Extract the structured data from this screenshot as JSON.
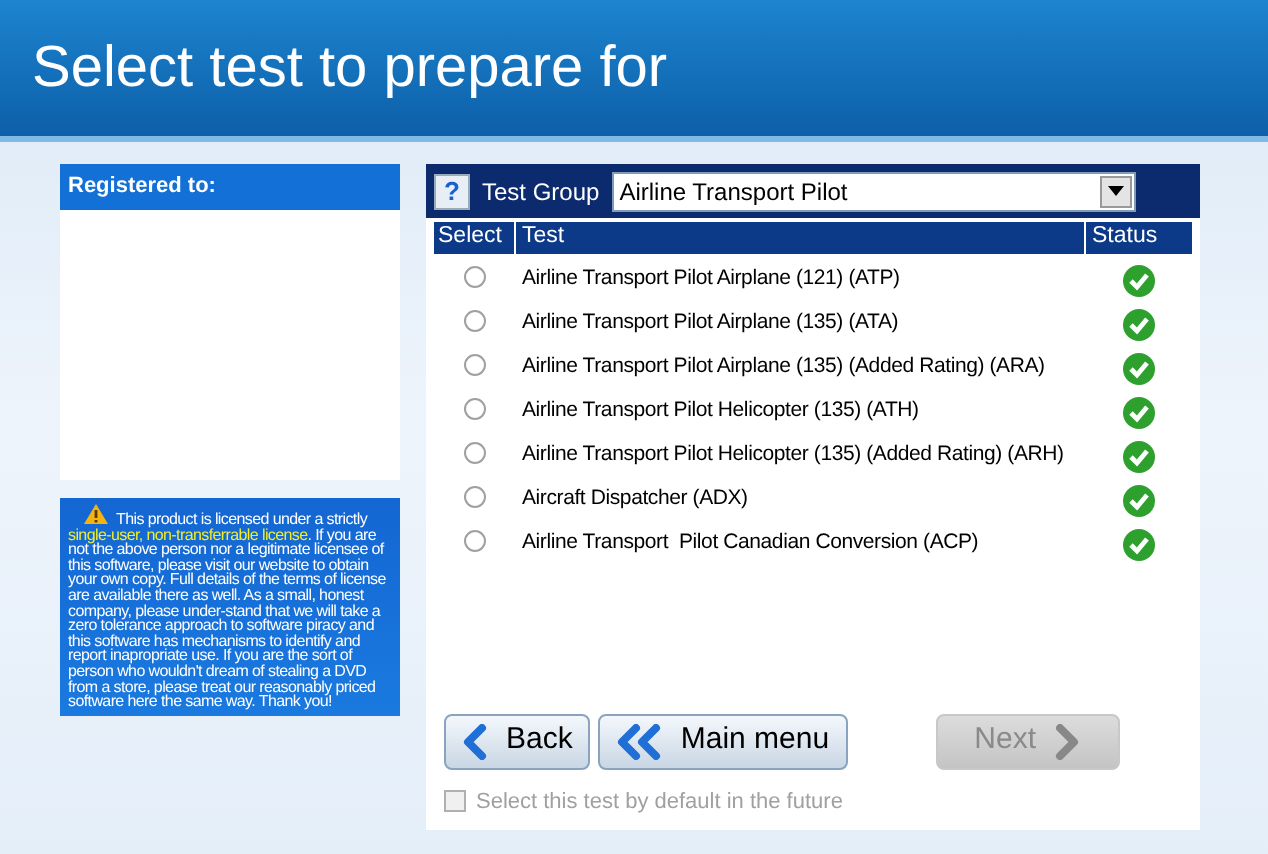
{
  "header": {
    "title": "Select test to prepare for"
  },
  "registration": {
    "heading": "Registered to:"
  },
  "license": {
    "text_before": "This product is licensed under a strictly ",
    "highlight": "single-user, non-transferrable license",
    "text_after": ".  If you are not the above person nor a legitimate licensee of this software, please visit our website to obtain your own copy.  Full details of the terms of license are available there as well. As a small, honest company, please under-stand that we will take a zero tolerance approach to software piracy and this software has mechanisms to identify and report inapropriate use.  If you are the sort of person who wouldn't dream of stealing a DVD from a store, please treat our reasonably priced software here the same way.  Thank you!"
  },
  "toolbar": {
    "help": "?",
    "label": "Test Group",
    "value": "Airline Transport Pilot"
  },
  "table": {
    "columns": [
      "Select",
      "Test",
      "Status"
    ],
    "rows": [
      {
        "test": "Airline Transport Pilot Airplane (121) (ATP)",
        "selected": false,
        "passed": true
      },
      {
        "test": "Airline Transport Pilot Airplane (135) (ATA)",
        "selected": false,
        "passed": true
      },
      {
        "test": "Airline Transport Pilot Airplane (135) (Added Rating) (ARA)",
        "selected": false,
        "passed": true
      },
      {
        "test": "Airline Transport Pilot Helicopter (135) (ATH)",
        "selected": false,
        "passed": true
      },
      {
        "test": "Airline Transport Pilot Helicopter (135) (Added Rating) (ARH)",
        "selected": false,
        "passed": true
      },
      {
        "test": "Aircraft Dispatcher (ADX)",
        "selected": false,
        "passed": true
      },
      {
        "test": "Airline Transport  Pilot Canadian Conversion (ACP)",
        "selected": false,
        "passed": true
      }
    ]
  },
  "buttons": [
    {
      "label": "Back",
      "kind": "back",
      "disabled": false
    },
    {
      "label": "Main menu",
      "kind": "home",
      "disabled": false
    },
    {
      "label": "Next",
      "kind": "next",
      "disabled": true
    }
  ],
  "default_option": {
    "label": "Select this test by default in the future",
    "checked": false,
    "disabled": true
  }
}
